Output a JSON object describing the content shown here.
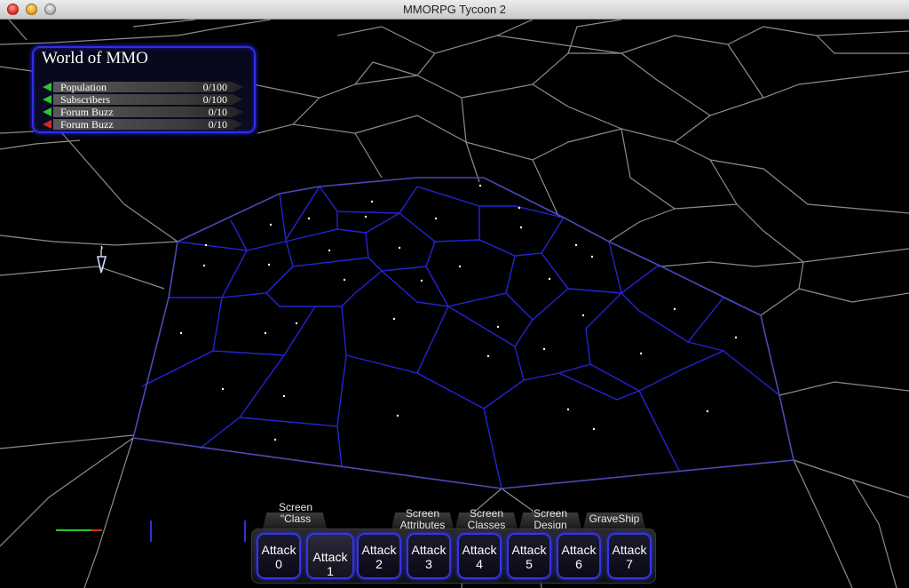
{
  "window": {
    "title": "MMORPG Tycoon 2"
  },
  "colors": {
    "map_line": "#8c8c8c",
    "zone_line": "#2424d6",
    "zone_outline": "#4a4ab8",
    "panel_border": "#2f2fe8",
    "up": "#2ec62e",
    "down": "#d02a2a"
  },
  "stats_panel": {
    "title": "World of MMO",
    "rows": [
      {
        "label": "Population",
        "value": "0/100",
        "trend": "up"
      },
      {
        "label": "Subscribers",
        "value": "0/100",
        "trend": "up"
      },
      {
        "label": "Forum Buzz",
        "value": "0/10",
        "trend": "up"
      },
      {
        "label": "Forum Buzz",
        "value": "0/10",
        "trend": "down"
      }
    ]
  },
  "screen_tabs": [
    {
      "label": "Screen\n\"Class"
    },
    {
      "label": "Screen\nAttributes"
    },
    {
      "label": "Screen\nClasses"
    },
    {
      "label": "Screen\nDesign"
    },
    {
      "label": "GraveShip"
    }
  ],
  "attack_buttons": [
    {
      "label": "Attack\n0"
    },
    {
      "label": "Attack 1"
    },
    {
      "label": "Attack\n2"
    },
    {
      "label": "Attack\n3"
    },
    {
      "label": "Attack\n4"
    },
    {
      "label": "Attack\n5"
    },
    {
      "label": "Attack\n6"
    },
    {
      "label": "Attack\n7"
    }
  ]
}
